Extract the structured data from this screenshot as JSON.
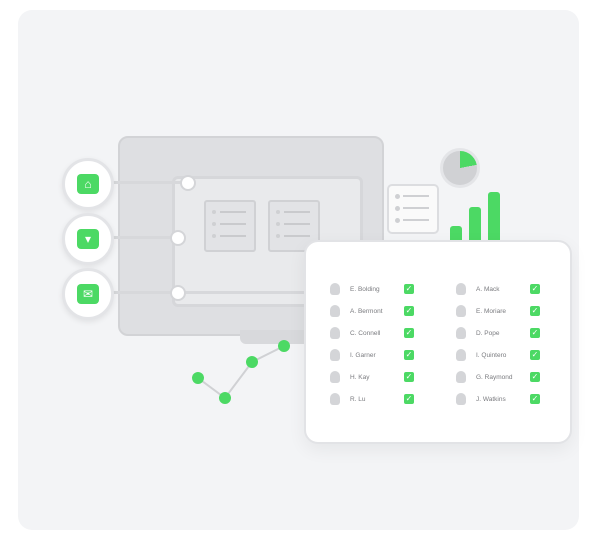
{
  "features": [
    {
      "icon": "lock-icon",
      "glyph": "⌂"
    },
    {
      "icon": "laptop-icon",
      "glyph": "▾"
    },
    {
      "icon": "mail-icon",
      "glyph": "✉"
    }
  ],
  "attendance": {
    "left_column": [
      "E. Bolding",
      "A. Bermont",
      "C. Connell",
      "I. Garner",
      "H. Kay",
      "R. Lu"
    ],
    "right_column": [
      "A. Mack",
      "E. Moriare",
      "D. Pope",
      "I. Quintero",
      "G. Raymond",
      "J. Watkins"
    ],
    "check_glyph": "✓"
  },
  "colors": {
    "accent": "#4cd964",
    "card_bg": "#f3f4f6",
    "neutral": "#d4d5d8"
  }
}
